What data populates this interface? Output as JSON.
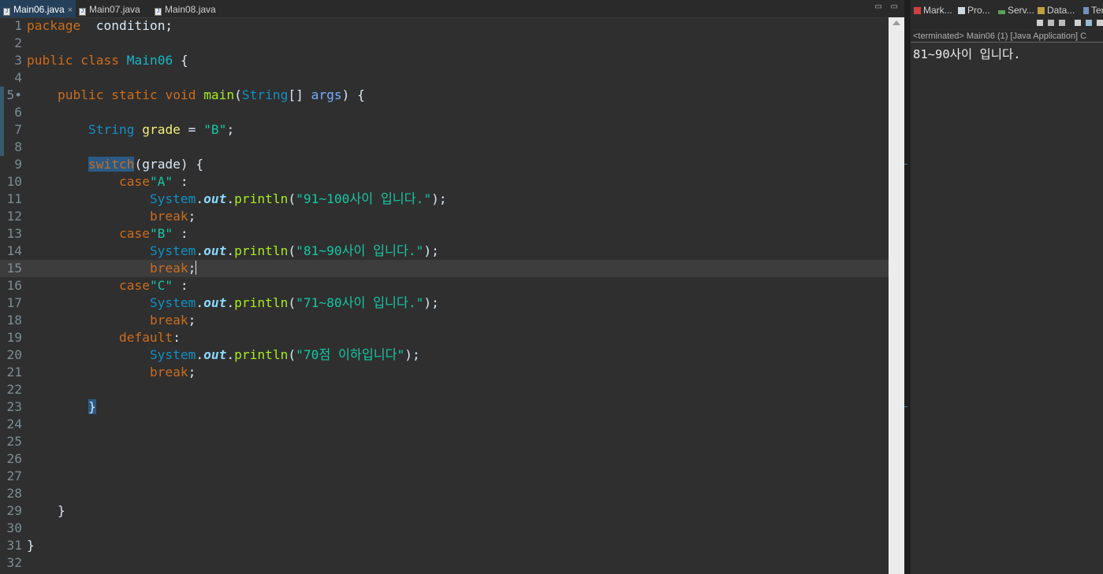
{
  "editor": {
    "tabs": [
      {
        "label": "Main06.java",
        "close": "×",
        "active": true
      },
      {
        "label": "Main07.java",
        "active": false
      },
      {
        "label": "Main08.java",
        "active": false
      }
    ],
    "window_controls": "▭ ▭",
    "lines": [
      {
        "n": "1",
        "tokens": [
          [
            "kw",
            "package"
          ],
          [
            "",
            "  condition;"
          ]
        ]
      },
      {
        "n": "2",
        "tokens": []
      },
      {
        "n": "3",
        "tokens": [
          [
            "kw",
            "public"
          ],
          [
            "",
            " "
          ],
          [
            "kw",
            "class"
          ],
          [
            "",
            " "
          ],
          [
            "cls",
            "Main06"
          ],
          [
            "",
            " {"
          ]
        ]
      },
      {
        "n": "4",
        "tokens": []
      },
      {
        "n": "5•",
        "tokens": [
          [
            "",
            "    "
          ],
          [
            "kw",
            "public"
          ],
          [
            "",
            " "
          ],
          [
            "kw",
            "static"
          ],
          [
            "",
            " "
          ],
          [
            "kw",
            "void"
          ],
          [
            "",
            " "
          ],
          [
            "mth",
            "main"
          ],
          [
            "",
            "("
          ],
          [
            "ty",
            "String"
          ],
          [
            "",
            "[] "
          ],
          [
            "prm",
            "args"
          ],
          [
            "",
            ") {"
          ]
        ]
      },
      {
        "n": "6",
        "tokens": []
      },
      {
        "n": "7",
        "tokens": [
          [
            "",
            "        "
          ],
          [
            "ty",
            "String"
          ],
          [
            "",
            " "
          ],
          [
            "var",
            "grade"
          ],
          [
            "",
            " = "
          ],
          [
            "str",
            "\"B\""
          ],
          [
            "",
            ";"
          ]
        ]
      },
      {
        "n": "8",
        "tokens": []
      },
      {
        "n": "9",
        "tokens": [
          [
            "",
            "        "
          ],
          [
            "kw hl",
            "switch"
          ],
          [
            "",
            "(grade) {"
          ]
        ]
      },
      {
        "n": "10",
        "tokens": [
          [
            "",
            "            "
          ],
          [
            "kw",
            "case"
          ],
          [
            "str",
            "\"A\""
          ],
          [
            "",
            " :"
          ]
        ]
      },
      {
        "n": "11",
        "tokens": [
          [
            "",
            "                "
          ],
          [
            "ty",
            "System"
          ],
          [
            "",
            "."
          ],
          [
            "fld",
            "out"
          ],
          [
            "",
            "."
          ],
          [
            "mth",
            "println"
          ],
          [
            "",
            "("
          ],
          [
            "str",
            "\"91~100사이 입니다.\""
          ],
          [
            "",
            ");"
          ]
        ]
      },
      {
        "n": "12",
        "tokens": [
          [
            "",
            "                "
          ],
          [
            "kw",
            "break"
          ],
          [
            "",
            ";"
          ]
        ]
      },
      {
        "n": "13",
        "tokens": [
          [
            "",
            "            "
          ],
          [
            "kw",
            "case"
          ],
          [
            "str",
            "\"B\""
          ],
          [
            "",
            " :"
          ]
        ]
      },
      {
        "n": "14",
        "tokens": [
          [
            "",
            "                "
          ],
          [
            "ty",
            "System"
          ],
          [
            "",
            "."
          ],
          [
            "fld",
            "out"
          ],
          [
            "",
            "."
          ],
          [
            "mth",
            "println"
          ],
          [
            "",
            "("
          ],
          [
            "str",
            "\"81~90사이 입니다.\""
          ],
          [
            "",
            ");"
          ]
        ]
      },
      {
        "n": "15",
        "tokens": [
          [
            "",
            "                "
          ],
          [
            "kw",
            "break"
          ],
          [
            "",
            ";"
          ]
        ],
        "caret": true
      },
      {
        "n": "16",
        "tokens": [
          [
            "",
            "            "
          ],
          [
            "kw",
            "case"
          ],
          [
            "str",
            "\"C\""
          ],
          [
            "",
            " :"
          ]
        ]
      },
      {
        "n": "17",
        "tokens": [
          [
            "",
            "                "
          ],
          [
            "ty",
            "System"
          ],
          [
            "",
            "."
          ],
          [
            "fld",
            "out"
          ],
          [
            "",
            "."
          ],
          [
            "mth",
            "println"
          ],
          [
            "",
            "("
          ],
          [
            "str",
            "\"71~80사이 입니다.\""
          ],
          [
            "",
            ");"
          ]
        ]
      },
      {
        "n": "18",
        "tokens": [
          [
            "",
            "                "
          ],
          [
            "kw",
            "break"
          ],
          [
            "",
            ";"
          ]
        ]
      },
      {
        "n": "19",
        "tokens": [
          [
            "",
            "            "
          ],
          [
            "kw",
            "default"
          ],
          [
            "",
            ":"
          ]
        ]
      },
      {
        "n": "20",
        "tokens": [
          [
            "",
            "                "
          ],
          [
            "ty",
            "System"
          ],
          [
            "",
            "."
          ],
          [
            "fld",
            "out"
          ],
          [
            "",
            "."
          ],
          [
            "mth",
            "println"
          ],
          [
            "",
            "("
          ],
          [
            "str",
            "\"70점 이하입니다\""
          ],
          [
            "",
            ");"
          ]
        ]
      },
      {
        "n": "21",
        "tokens": [
          [
            "",
            "                "
          ],
          [
            "kw",
            "break"
          ],
          [
            "",
            ";"
          ]
        ]
      },
      {
        "n": "22",
        "tokens": []
      },
      {
        "n": "23",
        "tokens": [
          [
            "",
            "        "
          ],
          [
            "hl",
            "}"
          ]
        ]
      },
      {
        "n": "24",
        "tokens": []
      },
      {
        "n": "25",
        "tokens": []
      },
      {
        "n": "26",
        "tokens": []
      },
      {
        "n": "27",
        "tokens": []
      },
      {
        "n": "28",
        "tokens": []
      },
      {
        "n": "29",
        "tokens": [
          [
            "",
            "    }"
          ]
        ]
      },
      {
        "n": "30",
        "tokens": []
      },
      {
        "n": "31",
        "tokens": [
          [
            "",
            "}"
          ]
        ]
      },
      {
        "n": "32",
        "tokens": []
      }
    ],
    "current_line": "15"
  },
  "console": {
    "tabs": [
      "Mark...",
      "Pro...",
      "Serv...",
      "Data...",
      "Ter"
    ],
    "status": "<terminated> Main06 (1) [Java Application] C",
    "output": "81~90사이 입니다."
  },
  "colors": {
    "background": "#2f2f2f",
    "keyword": "#cc6c1d",
    "type": "#1290c3",
    "string": "#17c6a3",
    "method": "#a7ec21",
    "variable": "#f3ec79",
    "selection": "#2a5a85"
  }
}
